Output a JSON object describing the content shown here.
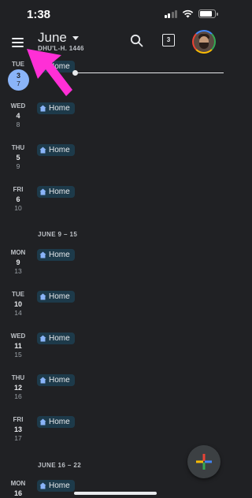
{
  "status_bar": {
    "time": "1:38",
    "battery_level": 0.9
  },
  "header": {
    "month": "June",
    "hijri_month": "DHU'L-H. 1446",
    "today_badge": "3",
    "icons": {
      "menu": "hamburger-menu-icon",
      "search": "search-icon",
      "avatar": "profile-avatar"
    }
  },
  "schedule": {
    "days": [
      {
        "dow": "TUE",
        "dom": "3",
        "hdom": "7",
        "event": "Home",
        "today": true
      },
      {
        "dow": "WED",
        "dom": "4",
        "hdom": "8",
        "event": "Home"
      },
      {
        "dow": "THU",
        "dom": "5",
        "hdom": "9",
        "event": "Home"
      },
      {
        "dow": "FRI",
        "dom": "6",
        "hdom": "10",
        "event": "Home"
      }
    ],
    "week2_header": "JUNE 9 – 15",
    "week2": [
      {
        "dow": "MON",
        "dom": "9",
        "hdom": "13",
        "event": "Home"
      },
      {
        "dow": "TUE",
        "dom": "10",
        "hdom": "14",
        "event": "Home"
      },
      {
        "dow": "WED",
        "dom": "11",
        "hdom": "15",
        "event": "Home"
      },
      {
        "dow": "THU",
        "dom": "12",
        "hdom": "16",
        "event": "Home"
      },
      {
        "dow": "FRI",
        "dom": "13",
        "hdom": "17",
        "event": "Home"
      }
    ],
    "week3_header": "JUNE 16 – 22",
    "week3": [
      {
        "dow": "MON",
        "dom": "16",
        "hdom": "",
        "event": "Home"
      }
    ]
  },
  "colors": {
    "background": "#202124",
    "today": "#8ab4f8",
    "chip": "#1d3a4a",
    "arrow": "#ff2fd6"
  },
  "fab_icon": "create-plus-icon"
}
